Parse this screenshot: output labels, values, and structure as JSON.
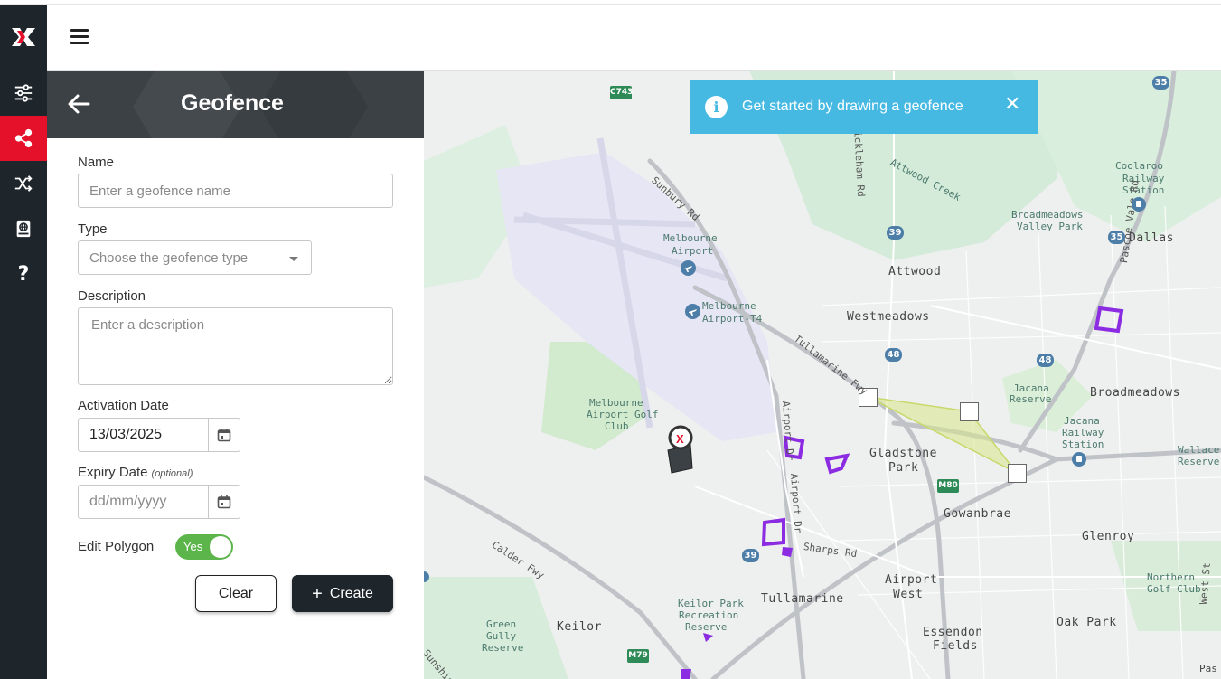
{
  "header": {
    "menu_icon": "hamburger-icon"
  },
  "sidebar": {
    "logo_icon": "app-logo-icon",
    "items": [
      {
        "name": "sliders-icon",
        "active": false
      },
      {
        "name": "share-icon",
        "active": true
      },
      {
        "name": "shuffle-icon",
        "active": false
      },
      {
        "name": "book-globe-icon",
        "active": false
      },
      {
        "name": "help-icon",
        "label": "?",
        "active": false
      }
    ],
    "active_color": "#e5112b"
  },
  "panel": {
    "title": "Geofence",
    "name": {
      "label": "Name",
      "placeholder": "Enter a geofence name",
      "value": ""
    },
    "type": {
      "label": "Type",
      "placeholder": "Choose the geofence type"
    },
    "description": {
      "label": "Description",
      "placeholder": "Enter a description",
      "value": ""
    },
    "activation_date": {
      "label": "Activation Date",
      "value": "13/03/2025"
    },
    "expiry_date": {
      "label": "Expiry Date",
      "optional": "(optional)",
      "placeholder": "dd/mm/yyyy"
    },
    "edit_polygon": {
      "label": "Edit Polygon",
      "toggle_text": "Yes",
      "on": true
    },
    "buttons": {
      "clear": "Clear",
      "create_plus": "+",
      "create": "Create"
    }
  },
  "map": {
    "toast": {
      "text": "Get started by drawing a geofence",
      "close": "✕",
      "icon": "info-icon"
    },
    "places": {
      "dallas": "Dallas",
      "attwood": "Attwood",
      "westmeadows": "Westmeadows",
      "broadmeadows": "Broadmeadows",
      "gladstone": "Gladstone",
      "park": "Park",
      "gowanbrae": "Gowanbrae",
      "glenroy": "Glenroy",
      "tullamarine": "Tullamarine",
      "airport": "Airport",
      "west": "West",
      "keilor": "Keilor",
      "oak_park": "Oak Park",
      "essendon": "Essendon",
      "fields": "Fields"
    },
    "pois": {
      "melbourne_airport_1": "Melbourne",
      "melbourne_airport_2": "Airport",
      "airport_t4_1": "Melbourne",
      "airport_t4_2": "Airport-T4",
      "golf_1": "Melbourne",
      "golf_2": "Airport Golf",
      "golf_3": "Club",
      "jacana_reserve_1": "Jacana",
      "jacana_reserve_2": "Reserve",
      "jacana_station_1": "Jacana",
      "jacana_station_2": "Railway",
      "jacana_station_3": "Station",
      "coolaroo_1": "Coolaroo",
      "coolaroo_2": "Railway",
      "coolaroo_3": "Station",
      "bvp_1": "Broadmeadows",
      "bvp_2": "Valley Park",
      "keilor_park_1": "Keilor Park",
      "keilor_park_2": "Recreation",
      "keilor_park_3": "Reserve",
      "green_gully_1": "Green",
      "green_gully_2": "Gully",
      "green_gully_3": "Reserve",
      "northern_golf_1": "Northern",
      "northern_golf_2": "Golf Club",
      "wallace_1": "Wallace",
      "wallace_2": "Reserve",
      "pas": "Pas"
    },
    "roads": {
      "sunbury": "Sunbury Rd",
      "mickleham": "Mickleham Rd",
      "attwood_creek": "Attwood Creek",
      "tullamarine_fwy": "Tullamarine Fwy",
      "airport_dr_1": "Airport Dr",
      "airport_dr_2": "Airport Dr",
      "sharps": "Sharps Rd",
      "calder": "Calder Fwy",
      "pascoe_vale": "Pascoe Vale Rd",
      "west_st": "West St",
      "sunshine": "Sunshine"
    },
    "shields": {
      "c743": "C743",
      "r35a": "35",
      "r35b": "35",
      "r39a": "39",
      "r39b": "39",
      "r48a": "48",
      "r48b": "48",
      "m80": "M80",
      "m79": "M79"
    },
    "geofence_fill_color": "#d9e68a",
    "existing_geofence_color": "#8b2be2"
  }
}
